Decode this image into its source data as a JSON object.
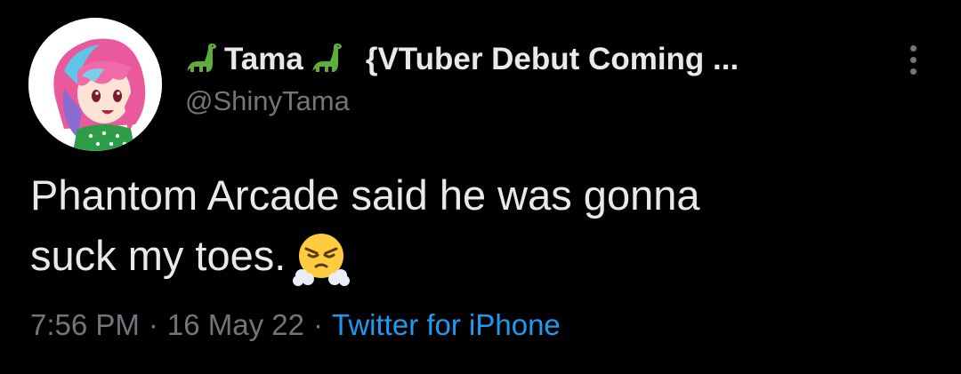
{
  "tweet": {
    "display_name_part1": "Tama",
    "display_name_part2": "{VTuber Debut Coming ...",
    "handle": "@ShinyTama",
    "text_line1": "Phantom Arcade said he was gonna",
    "text_line2": "suck my toes.",
    "time": "7:56 PM",
    "separator": "·",
    "date": "16 May 22",
    "source": "Twitter for iPhone"
  },
  "icons": {
    "dinosaur": "sauropod-emoji",
    "face": "face-with-steam-from-nose-emoji",
    "more": "more-options-icon"
  },
  "colors": {
    "background": "#000000",
    "primary_text": "#e7e9ea",
    "secondary_text": "#71767b",
    "link": "#1d9bf0",
    "dino_green": "#5fae3a"
  }
}
